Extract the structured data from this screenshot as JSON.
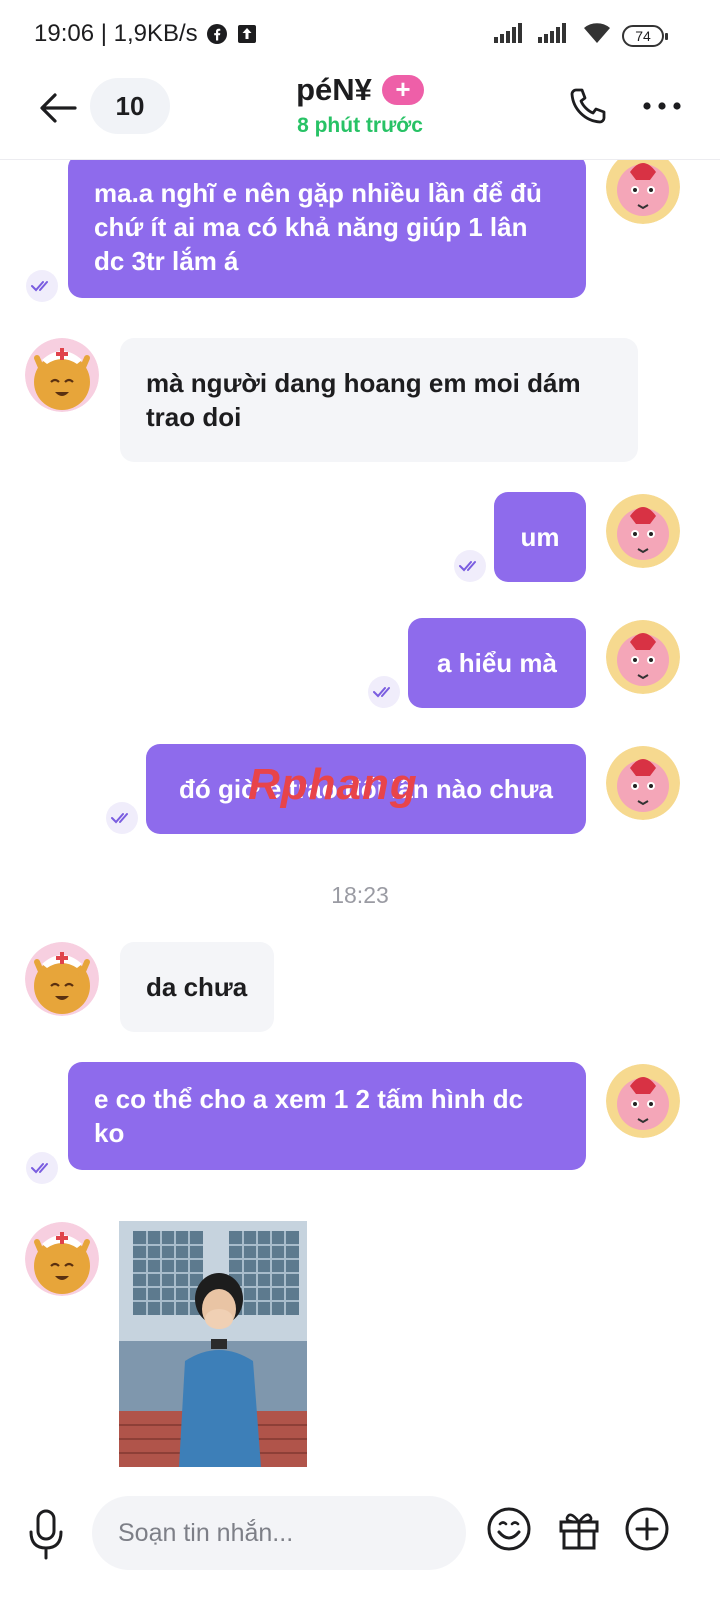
{
  "status_bar": {
    "time_speed": "19:06 | 1,9KB/s",
    "battery": "74"
  },
  "header": {
    "unread_count": "10",
    "contact_name": "péN¥",
    "badge": "+",
    "last_seen": "8 phút trước"
  },
  "messages": [
    {
      "dir": "out",
      "text": "ma.a nghĩ e nên gặp nhiều lần để đủ chứ ít ai ma có khả năng giúp 1 lân dc 3tr lắm á"
    },
    {
      "dir": "in",
      "text": "mà người dang hoang em moi dám trao doi"
    },
    {
      "dir": "out",
      "text": "um"
    },
    {
      "dir": "out",
      "text": "a hiểu mà"
    },
    {
      "dir": "out",
      "text": "đó giờ e trao đổi lần nào chưa"
    },
    {
      "dir": "in",
      "text": "da chưa"
    },
    {
      "dir": "out",
      "text": "e co thể cho a xem 1 2 tấm hình dc ko"
    }
  ],
  "time_separator": "18:23",
  "watermark": "Rphang",
  "input": {
    "placeholder": "Soạn tin nhắn..."
  },
  "colors": {
    "outgoing_bubble": "#8e6bec",
    "incoming_bubble": "#f4f5f8",
    "online_green": "#27c265",
    "badge_pink": "#ee5fa8"
  }
}
